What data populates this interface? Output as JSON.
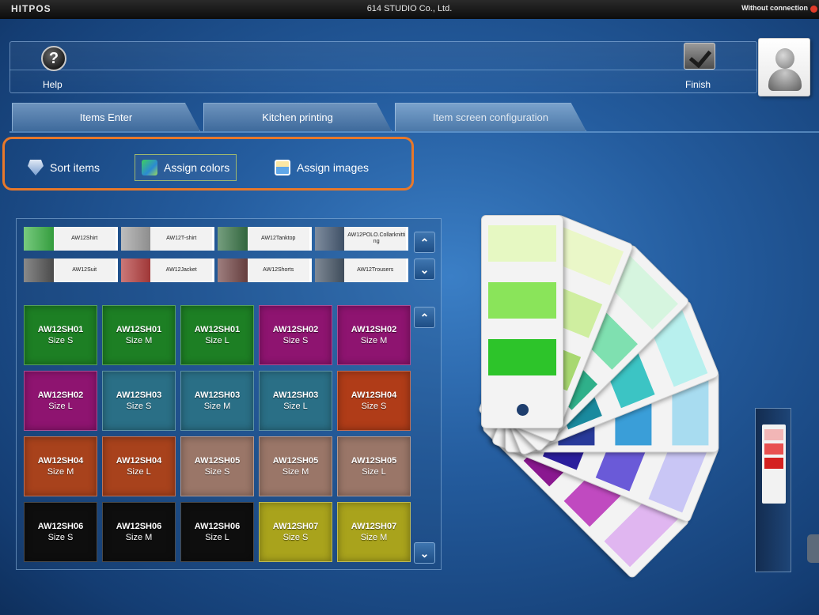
{
  "window": {
    "logo": "HITPOS",
    "title": "614 STUDIO Co., Ltd.",
    "connection": "Without connection"
  },
  "toolbar": {
    "help_label": "Help",
    "finish_label": "Finish"
  },
  "tabs": [
    {
      "label": "Items Enter",
      "active": false
    },
    {
      "label": "Kitchen printing",
      "active": false
    },
    {
      "label": "Item screen configuration",
      "active": true
    }
  ],
  "subtoolbar": {
    "sort": "Sort items",
    "colors": "Assign colors",
    "images": "Assign images",
    "active": "Assign colors"
  },
  "categories": [
    [
      {
        "label": "AW12Shirt",
        "color": "#2fae3a"
      },
      {
        "label": "AW12T-shirt",
        "color": "#9a9a9a"
      },
      {
        "label": "AW12Tanktop",
        "color": "#2c6b3a"
      },
      {
        "label": "AW12POLO.Collarknitting",
        "color": "#3a4f6a"
      }
    ],
    [
      {
        "label": "AW12Suit",
        "color": "#4a4a4a"
      },
      {
        "label": "AW12Jacket",
        "color": "#b03030"
      },
      {
        "label": "AW12Shorts",
        "color": "#6a3a3a"
      },
      {
        "label": "AW12Trousers",
        "color": "#3a4a5c"
      }
    ]
  ],
  "items": [
    {
      "code": "AW12SH01",
      "size": "Size S",
      "color": "#1d7f24"
    },
    {
      "code": "AW12SH01",
      "size": "Size M",
      "color": "#1d7f24"
    },
    {
      "code": "AW12SH01",
      "size": "Size L",
      "color": "#1d7f24"
    },
    {
      "code": "AW12SH02",
      "size": "Size S",
      "color": "#8e1470"
    },
    {
      "code": "AW12SH02",
      "size": "Size M",
      "color": "#8e1470"
    },
    {
      "code": "AW12SH02",
      "size": "Size L",
      "color": "#8e1470"
    },
    {
      "code": "AW12SH03",
      "size": "Size S",
      "color": "#2a6f86"
    },
    {
      "code": "AW12SH03",
      "size": "Size M",
      "color": "#2a6f86"
    },
    {
      "code": "AW12SH03",
      "size": "Size L",
      "color": "#2a6f86"
    },
    {
      "code": "AW12SH04",
      "size": "Size S",
      "color": "#b03c18"
    },
    {
      "code": "AW12SH04",
      "size": "Size M",
      "color": "#a8421c"
    },
    {
      "code": "AW12SH04",
      "size": "Size L",
      "color": "#a8421c"
    },
    {
      "code": "AW12SH05",
      "size": "Size S",
      "color": "#9a7668"
    },
    {
      "code": "AW12SH05",
      "size": "Size M",
      "color": "#9a7668"
    },
    {
      "code": "AW12SH05",
      "size": "Size L",
      "color": "#9a7668"
    },
    {
      "code": "AW12SH06",
      "size": "Size S",
      "color": "#0e0e0e"
    },
    {
      "code": "AW12SH06",
      "size": "Size M",
      "color": "#0e0e0e"
    },
    {
      "code": "AW12SH06",
      "size": "Size L",
      "color": "#0e0e0e"
    },
    {
      "code": "AW12SH07",
      "size": "Size S",
      "color": "#a9a31c"
    },
    {
      "code": "AW12SH07",
      "size": "Size M",
      "color": "#a9a31c"
    }
  ],
  "palette_cards": [
    {
      "swatches": [
        "#e6f8c2",
        "#8ae45a",
        "#2dc42a"
      ]
    },
    {
      "swatches": [
        "#eaf7c8",
        "#cfeea0",
        "#a8d870"
      ]
    },
    {
      "swatches": [
        "#d6f5df",
        "#7fe0b0",
        "#2fb08a"
      ]
    },
    {
      "swatches": [
        "#b8f0ee",
        "#3cc4c4",
        "#1a8a9e"
      ]
    },
    {
      "swatches": [
        "#a8dcf0",
        "#3a9ed8",
        "#283a9a"
      ]
    },
    {
      "swatches": [
        "#c9c6f5",
        "#6a5ad8",
        "#2b1e9c"
      ]
    },
    {
      "swatches": [
        "#e0b6f0",
        "#c04ac0",
        "#8a1890"
      ]
    }
  ],
  "mini_palette": [
    "#f2b6b6",
    "#e85050",
    "#d42020"
  ]
}
